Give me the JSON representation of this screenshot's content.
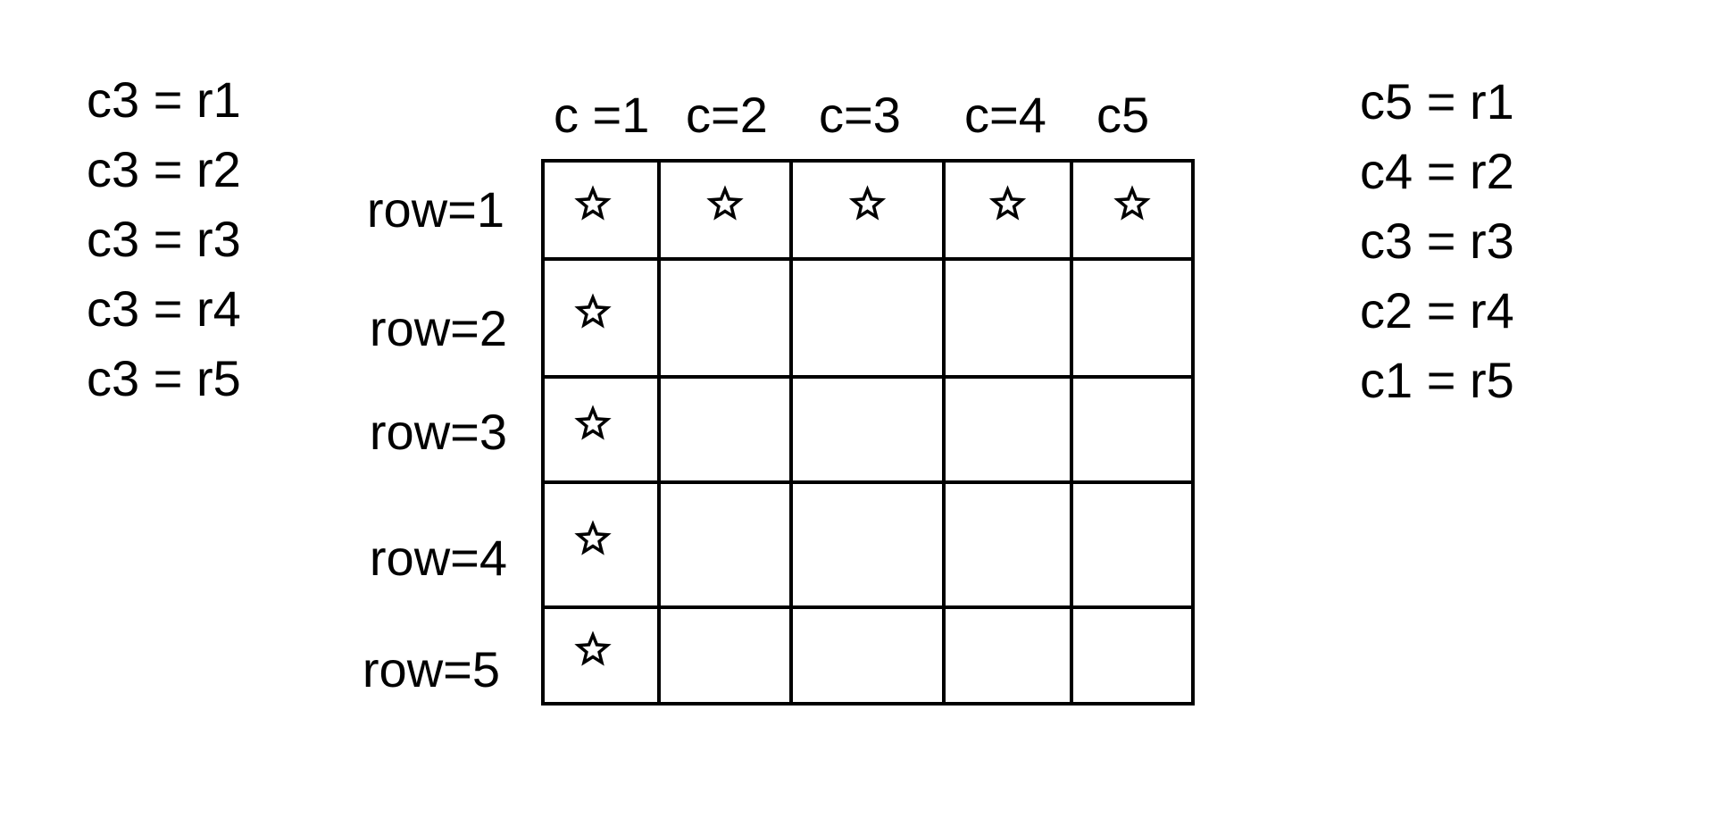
{
  "left_list": [
    "c3 = r1",
    "c3 = r2",
    "c3 = r3",
    "c3 = r4",
    "c3 = r5"
  ],
  "right_list": [
    "c5 = r1",
    "c4 = r2",
    "c3 = r3",
    "c2 = r4",
    "c1 = r5"
  ],
  "column_headers": [
    "c =1",
    "c=2",
    "c=3",
    "c=4",
    "c5"
  ],
  "row_headers": [
    "row=1",
    "row=2",
    "row=3",
    "row=4",
    "row=5"
  ],
  "star_cells": [
    [
      1,
      1
    ],
    [
      1,
      2
    ],
    [
      1,
      3
    ],
    [
      1,
      4
    ],
    [
      1,
      5
    ],
    [
      2,
      1
    ],
    [
      3,
      1
    ],
    [
      4,
      1
    ],
    [
      5,
      1
    ]
  ],
  "star_icon": "star-outline-icon",
  "line_color": "#000000"
}
